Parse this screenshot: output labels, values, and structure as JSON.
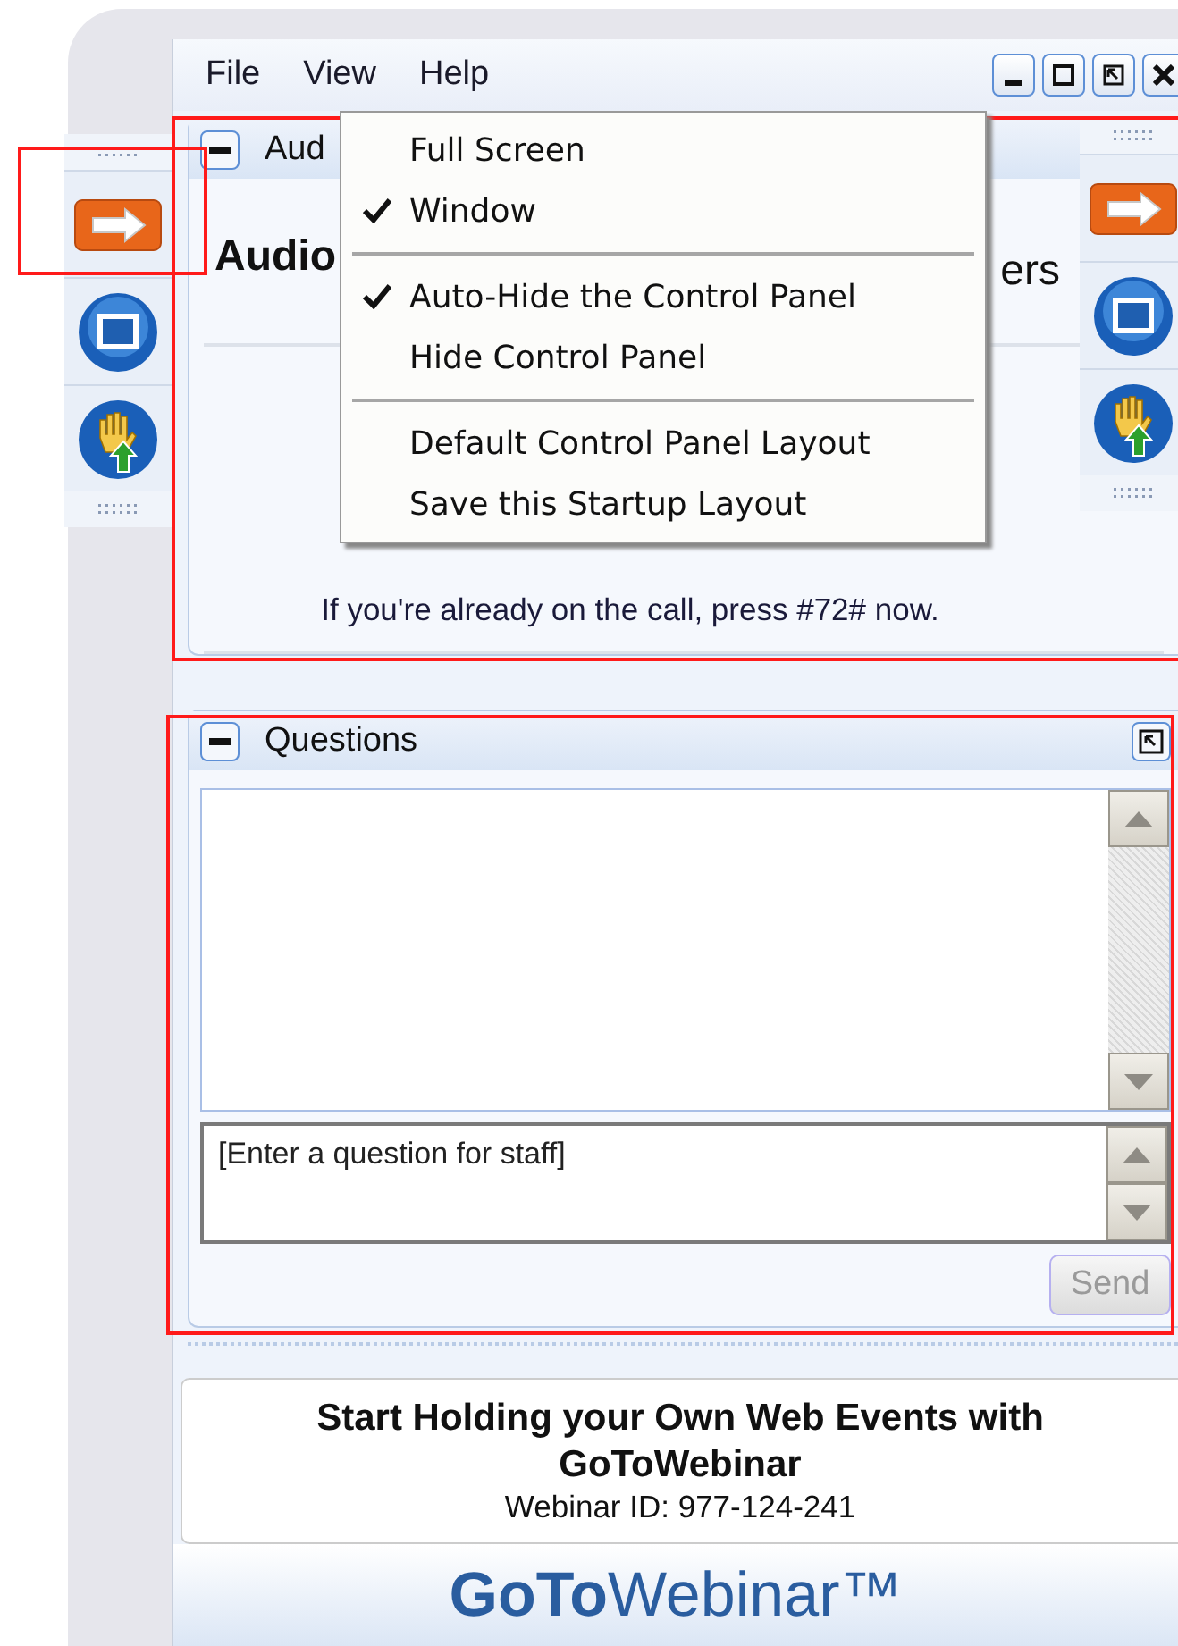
{
  "menu_bar": [
    {
      "label": "File"
    },
    {
      "label": "View"
    },
    {
      "label": "Help"
    }
  ],
  "audio_panel": {
    "header": "Aud",
    "title_start": "Audio",
    "title_end": "ers",
    "instruction": "If you're already on the call, press #72# now."
  },
  "view_menu": [
    {
      "kind": "item",
      "label": "Full Screen",
      "checked": false
    },
    {
      "kind": "item",
      "label": "Window",
      "checked": true
    },
    {
      "kind": "separator"
    },
    {
      "kind": "item",
      "label": "Auto-Hide the Control Panel",
      "checked": true
    },
    {
      "kind": "item",
      "label": "Hide Control Panel",
      "checked": false
    },
    {
      "kind": "separator"
    },
    {
      "kind": "item",
      "label": "Default Control Panel Layout",
      "checked": false
    },
    {
      "kind": "item",
      "label": "Save this Startup Layout",
      "checked": false
    }
  ],
  "questions_panel": {
    "header": "Questions",
    "input": {
      "placeholder": "[Enter a question for staff]"
    },
    "send_button": {
      "label": "Send",
      "disabled": true
    }
  },
  "promo": {
    "headline": "Start Holding your Own Web Events with GoToWebinar",
    "webinar_id": "Webinar ID: 977-124-241"
  },
  "logo": "**GoTo**Webinar™"
}
